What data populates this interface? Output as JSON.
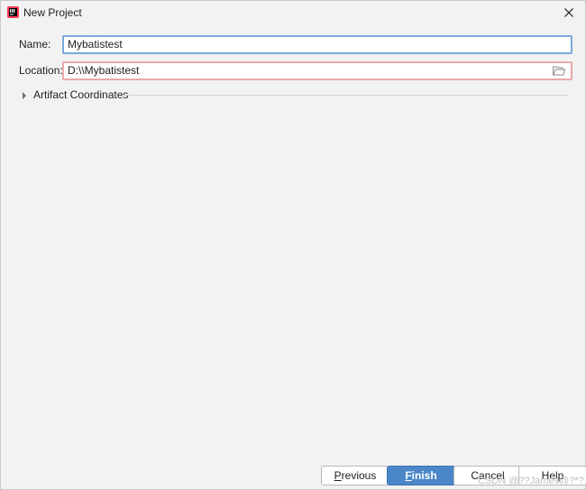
{
  "window": {
    "title": "New Project",
    "icon": "intellij-idea-icon"
  },
  "form": {
    "name_label": "Name:",
    "name_value": "Mybatistest",
    "location_label": "Location:",
    "location_value": "D:\\\\Mybatistest",
    "artifact_label": "Artifact Coordinates"
  },
  "buttons": {
    "previous_first": "P",
    "previous_rest": "revious",
    "finish_first": "F",
    "finish_rest": "inish",
    "cancel": "Cancel",
    "help": "Help"
  },
  "watermark": "CSDN @??James@?*?",
  "colors": {
    "finish_button": "#4a86c8",
    "name_border": "#7aa9dc",
    "location_border_error": "#e8a9a9"
  }
}
